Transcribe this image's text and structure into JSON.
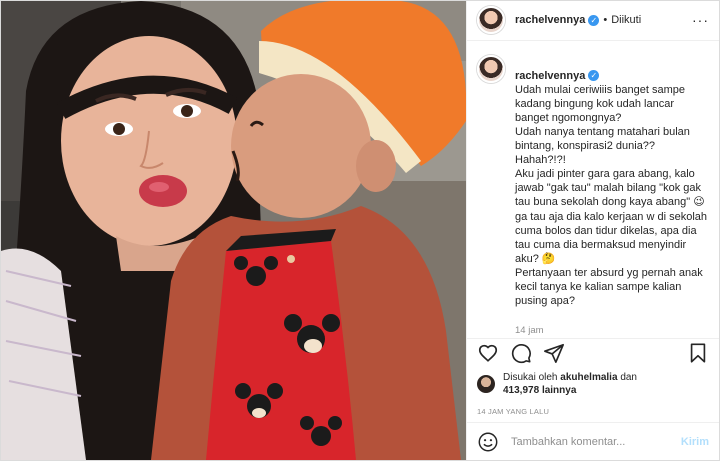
{
  "post": {
    "username": "rachelvennya",
    "follow_separator": "•",
    "follow_status": "Diikuti",
    "more_glyph": "···",
    "caption": {
      "username": "rachelvennya",
      "text": "Udah mulai ceriwiiis banget sampe kadang bingung kok udah lancar banget ngomongnya?\nUdah nanya tentang matahari bulan bintang, konspirasi2 dunia??\nHahah?!?!\nAku jadi pinter gara gara abang, kalo jawab \"gak tau\" malah bilang \"kok gak tau buna sekolah dong kaya abang\" 😉 ga tau aja dia kalo kerjaan w di sekolah cuma bolos dan tidur dikelas, apa dia tau cuma dia bermaksud menyindir aku? 🤔\nPertanyaan ter absurd yg pernah anak kecil tanya ke kalian sampe kalian pusing apa?",
      "time": "14 jam"
    },
    "likes": {
      "prefix": "Disukai oleh",
      "liker": "akuhelmalia",
      "conj": "dan",
      "count": "413,978",
      "suffix": "lainnya"
    },
    "posted_ago": "14 JAM YANG LALU",
    "comment": {
      "placeholder": "Tambahkan komentar...",
      "send_label": "Kirim"
    }
  },
  "colors": {
    "accent": "#3897f0",
    "send_disabled": "#b2dffc",
    "muted": "#8e8e8e",
    "apron_red": "#d8252b",
    "hat_orange": "#f07a2a"
  },
  "icons": [
    "heart-icon",
    "comment-icon",
    "share-icon",
    "bookmark-icon",
    "emoji-icon",
    "verified-icon",
    "more-icon"
  ]
}
